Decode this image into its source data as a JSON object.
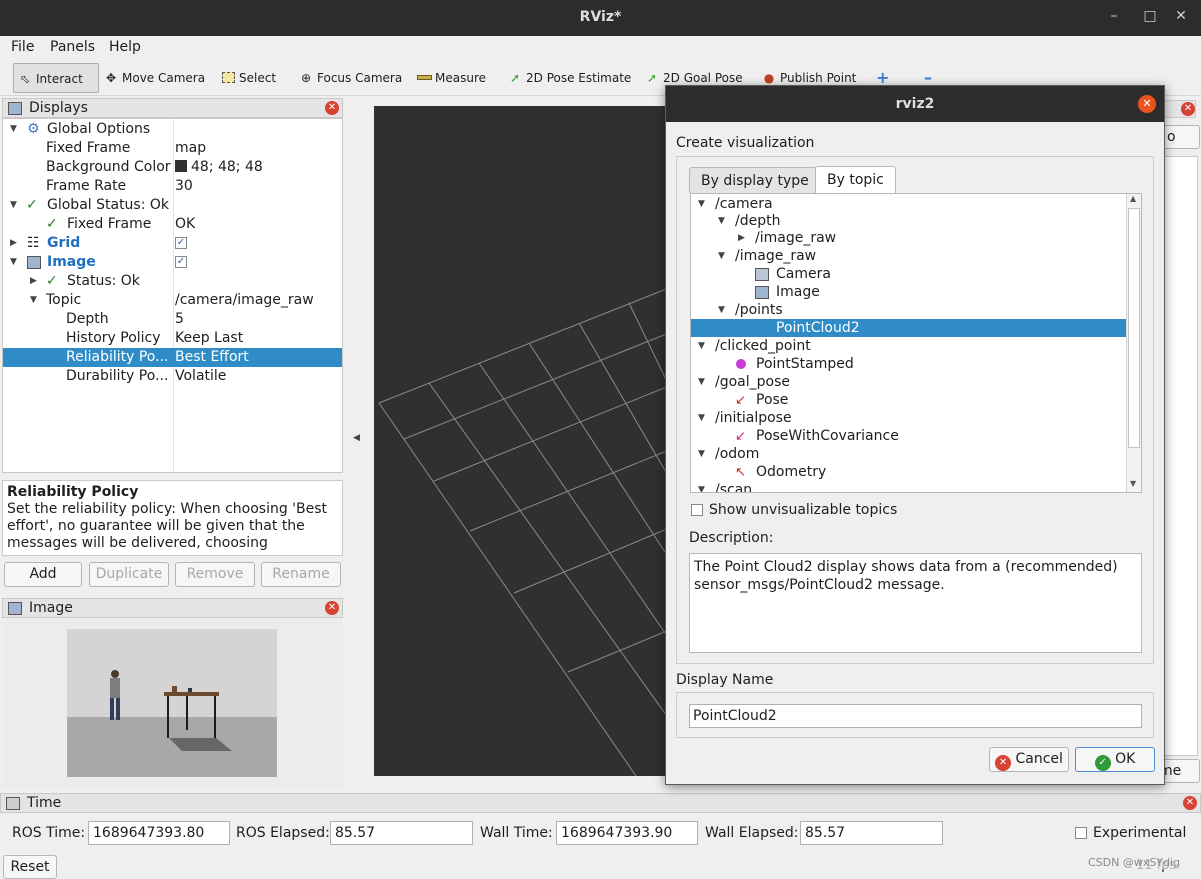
{
  "window": {
    "title": "RViz*"
  },
  "menu": [
    "File",
    "Panels",
    "Help"
  ],
  "toolbar": {
    "interact": "Interact",
    "move_camera": "Move Camera",
    "select": "Select",
    "focus_camera": "Focus Camera",
    "measure": "Measure",
    "pose_estimate": "2D Pose Estimate",
    "goal_pose": "2D Goal Pose",
    "publish_point": "Publish Point"
  },
  "displays": {
    "title": "Displays",
    "rows": {
      "global_options": "Global Options",
      "fixed_frame_k": "Fixed Frame",
      "fixed_frame_v": "map",
      "bg_color_k": "Background Color",
      "bg_color_v": "48; 48; 48",
      "frame_rate_k": "Frame Rate",
      "frame_rate_v": "30",
      "global_status": "Global Status: Ok",
      "gs_fixed_frame_k": "Fixed Frame",
      "gs_fixed_frame_v": "OK",
      "grid": "Grid",
      "image": "Image",
      "status_ok": "Status: Ok",
      "topic_k": "Topic",
      "topic_v": "/camera/image_raw",
      "depth_k": "Depth",
      "depth_v": "5",
      "history_k": "History Policy",
      "history_v": "Keep Last",
      "reliability_k": "Reliability Po...",
      "reliability_v": "Best Effort",
      "durability_k": "Durability Po...",
      "durability_v": "Volatile"
    },
    "description_title": "Reliability Policy",
    "description_text": "Set the reliability policy: When choosing 'Best effort', no guarantee will be given that the messages will be delivered, choosing",
    "buttons": {
      "add": "Add",
      "duplicate": "Duplicate",
      "remove": "Remove",
      "rename": "Rename"
    }
  },
  "image_panel": {
    "title": "Image"
  },
  "time": {
    "title": "Time",
    "ros_time_label": "ROS Time:",
    "ros_time": "1689647393.80",
    "ros_elapsed_label": "ROS Elapsed:",
    "ros_elapsed": "85.57",
    "wall_time_label": "Wall Time:",
    "wall_time": "1689647393.90",
    "wall_elapsed_label": "Wall Elapsed:",
    "wall_elapsed": "85.57",
    "experimental": "Experimental",
    "reset": "Reset",
    "fps": "11 fps"
  },
  "right_panel": {
    "partial_1": "o",
    "partial_2": "me"
  },
  "watermark": "CSDN @wxSYdig",
  "dialog": {
    "title": "rviz2",
    "create_label": "Create visualization",
    "tab_display_type": "By display type",
    "tab_topic": "By topic",
    "tree": {
      "camera": "/camera",
      "depth": "/depth",
      "depth_image_raw": "/image_raw",
      "image_raw": "/image_raw",
      "camera_item": "Camera",
      "image_item": "Image",
      "points": "/points",
      "pointcloud2": "PointCloud2",
      "clicked_point": "/clicked_point",
      "point_stamped": "PointStamped",
      "goal_pose": "/goal_pose",
      "pose": "Pose",
      "initialpose": "/initialpose",
      "pose_cov": "PoseWithCovariance",
      "odom": "/odom",
      "odometry": "Odometry",
      "scan": "/scan"
    },
    "show_unvisualizable": "Show unvisualizable topics",
    "description_label": "Description:",
    "description_text": "The Point Cloud2 display shows data from a (recommended) sensor_msgs/PointCloud2 message.",
    "display_name_label": "Display Name",
    "display_name_value": "PointCloud2",
    "cancel": "Cancel",
    "ok": "OK"
  }
}
